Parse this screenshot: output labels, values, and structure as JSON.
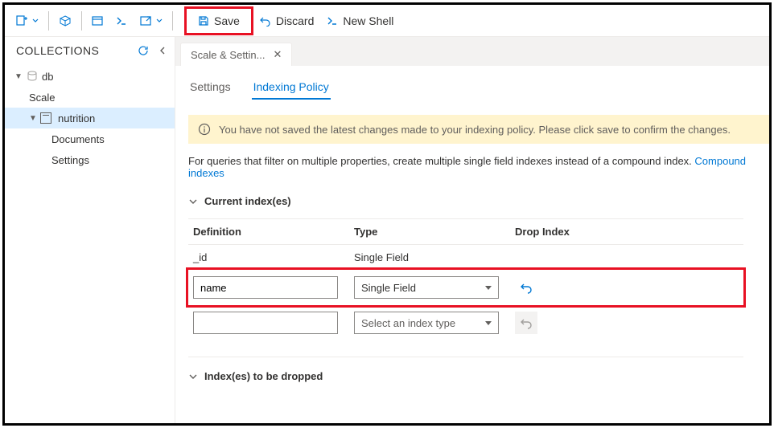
{
  "toolbar": {
    "save_label": "Save",
    "discard_label": "Discard",
    "newshell_label": "New Shell"
  },
  "sidebar": {
    "title": "COLLECTIONS",
    "db": "db",
    "scale": "Scale",
    "nutrition": "nutrition",
    "documents": "Documents",
    "settings": "Settings"
  },
  "tab": {
    "label": "Scale & Settin..."
  },
  "subtabs": {
    "settings": "Settings",
    "indexing": "Indexing Policy"
  },
  "banner": "You have not saved the latest changes made to your indexing policy. Please click save to confirm the changes.",
  "desc_text": "For queries that filter on multiple properties, create multiple single field indexes instead of a compound index. ",
  "desc_link": "Compound indexes",
  "sections": {
    "current": "Current index(es)",
    "dropped": "Index(es) to be dropped"
  },
  "headers": {
    "definition": "Definition",
    "type": "Type",
    "drop": "Drop Index"
  },
  "rows": {
    "id_def": "_id",
    "id_type": "Single Field",
    "name_def": "name",
    "name_type": "Single Field",
    "select_placeholder": "Select an index type"
  }
}
